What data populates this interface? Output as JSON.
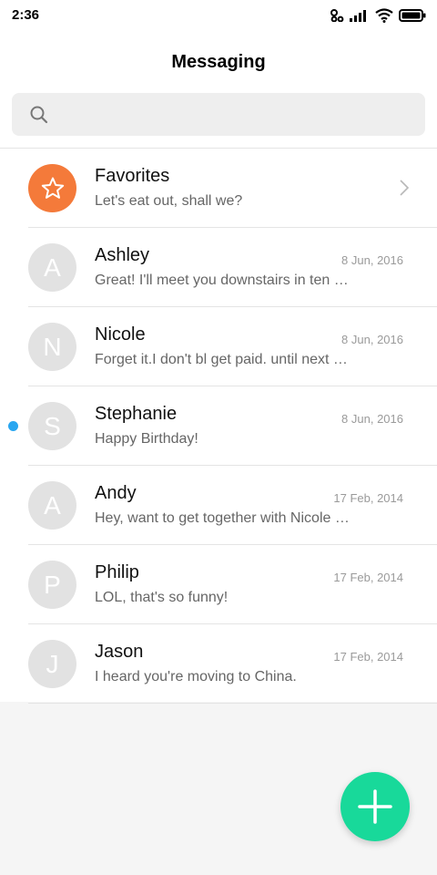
{
  "status_bar": {
    "time": "2:36",
    "icons": [
      "link-icon",
      "signal-icon",
      "wifi-icon",
      "battery-icon"
    ]
  },
  "header": {
    "title": "Messaging",
    "search": {
      "placeholder": "",
      "icon": "search-icon"
    }
  },
  "colors": {
    "favorites_avatar": "#f47a3a",
    "fab": "#18d99a",
    "unread_dot": "#29a6f0",
    "avatar_gray": "#e2e2e2"
  },
  "conversations": [
    {
      "name": "Favorites",
      "preview": "Let's eat out, shall we?",
      "date": "",
      "avatar_icon": "star-icon",
      "has_chevron": true,
      "unread": false
    },
    {
      "name": "Ashley",
      "letter": "A",
      "preview": "Great! I'll meet you downstairs in ten minutes.",
      "date": "8 Jun, 2016",
      "unread": false
    },
    {
      "name": "Nicole",
      "letter": "N",
      "preview": "Forget it.I don't bl get paid. until next Friday.",
      "date": "8 Jun, 2016",
      "unread": false
    },
    {
      "name": "Stephanie",
      "letter": "S",
      "preview": "Happy Birthday!",
      "date": "8 Jun, 2016",
      "unread": true
    },
    {
      "name": "Andy",
      "letter": "A",
      "preview": "Hey, want to get together with Nicole tonight?",
      "date": "17 Feb, 2014",
      "unread": false
    },
    {
      "name": "Philip",
      "letter": "P",
      "preview": "LOL, that's so funny!",
      "date": "17 Feb, 2014",
      "unread": false
    },
    {
      "name": "Jason",
      "letter": "J",
      "preview": "I heard you're moving to China.",
      "date": "17 Feb, 2014",
      "unread": false
    }
  ],
  "fab": {
    "icon": "plus-icon"
  }
}
